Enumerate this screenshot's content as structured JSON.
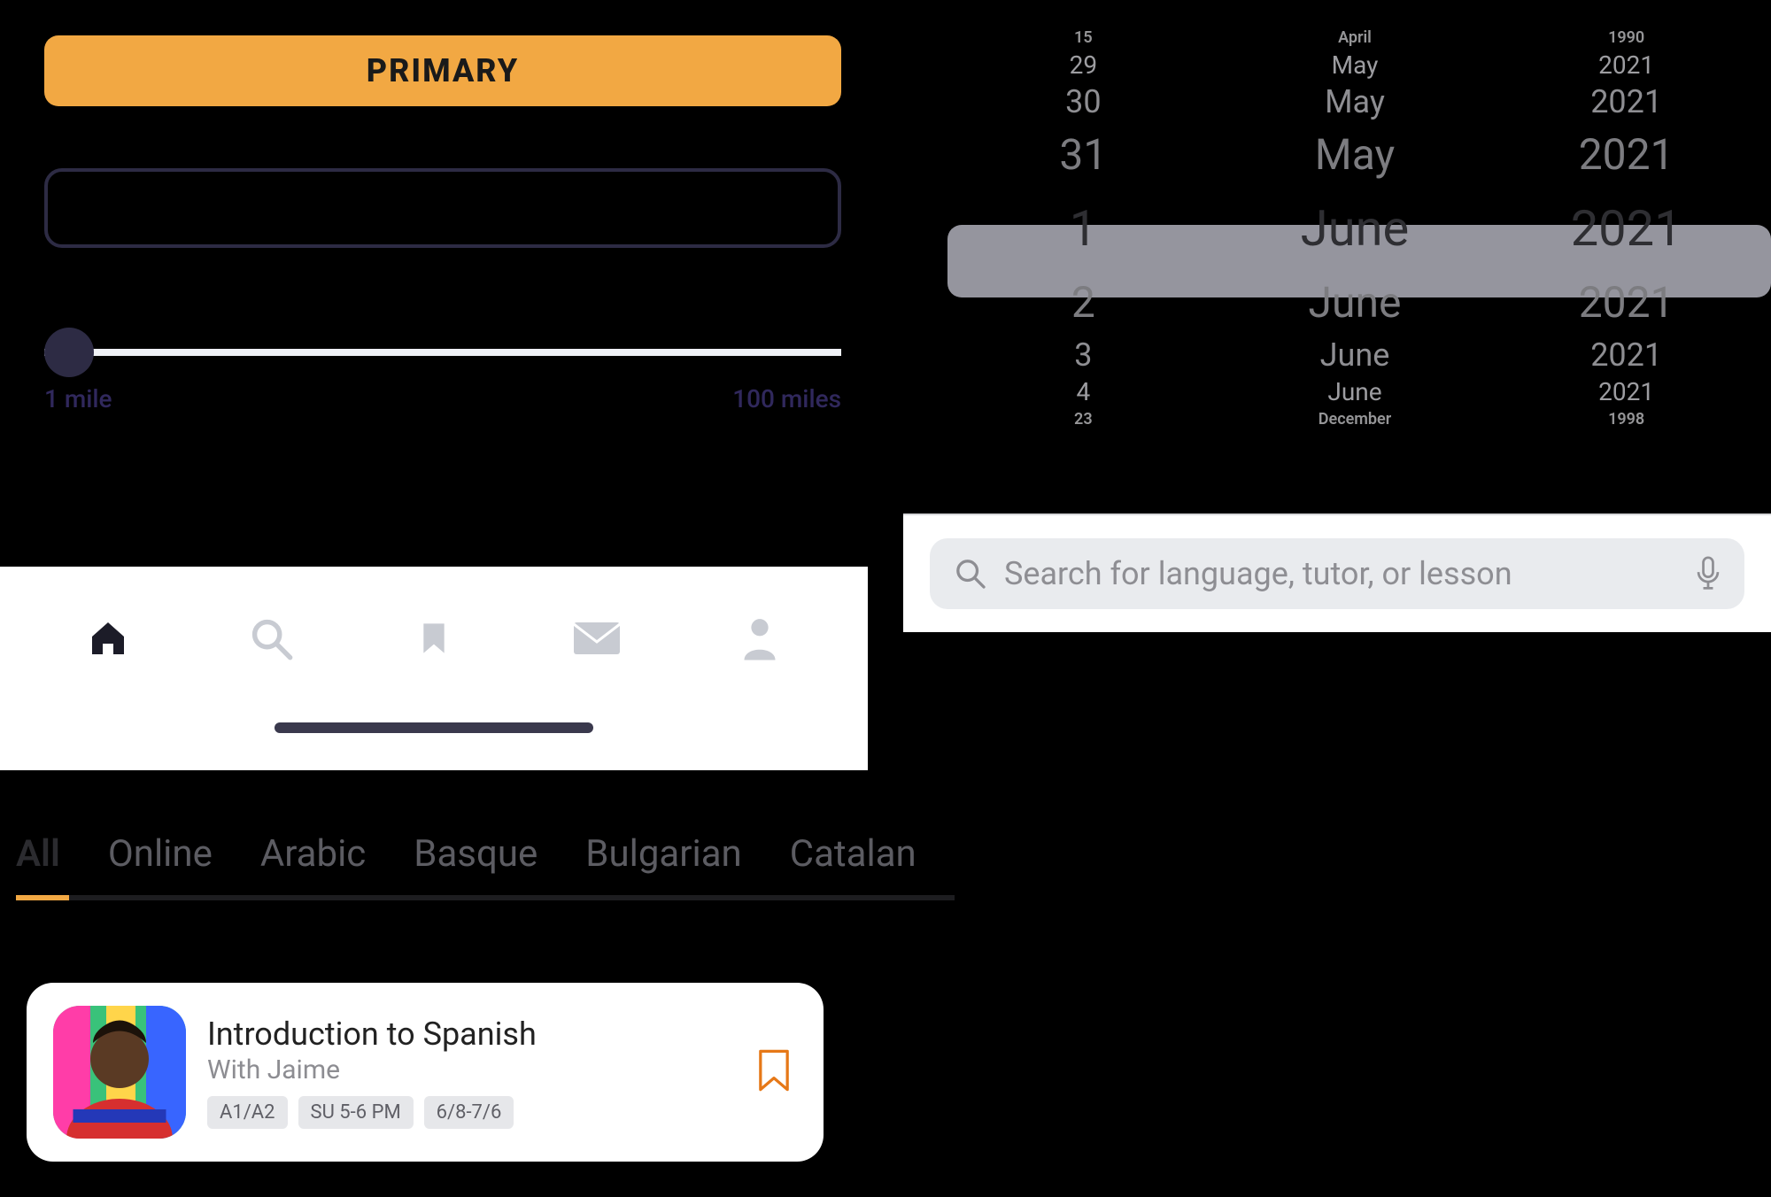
{
  "primary_button": {
    "label": "PRIMARY"
  },
  "slider": {
    "min_label": "1 mile",
    "max_label": "100 miles"
  },
  "nav": {
    "items": [
      {
        "name": "home",
        "active": true
      },
      {
        "name": "search",
        "active": false
      },
      {
        "name": "bookmark",
        "active": false
      },
      {
        "name": "mail",
        "active": false
      },
      {
        "name": "profile",
        "active": false
      }
    ]
  },
  "date_picker": {
    "rows": [
      {
        "day": "15",
        "month": "April",
        "year": "1990",
        "size": "tiny"
      },
      {
        "day": "29",
        "month": "May",
        "year": "2021",
        "size": "sm"
      },
      {
        "day": "30",
        "month": "May",
        "year": "2021",
        "size": "md"
      },
      {
        "day": "31",
        "month": "May",
        "year": "2021",
        "size": "lg"
      },
      {
        "day": "1",
        "month": "June",
        "year": "2021",
        "size": "sel"
      },
      {
        "day": "2",
        "month": "June",
        "year": "2021",
        "size": "lg"
      },
      {
        "day": "3",
        "month": "June",
        "year": "2021",
        "size": "md"
      },
      {
        "day": "4",
        "month": "June",
        "year": "2021",
        "size": "sm"
      },
      {
        "day": "23",
        "month": "December",
        "year": "1998",
        "size": "tiny"
      }
    ]
  },
  "search": {
    "placeholder": "Search for language, tutor, or lesson"
  },
  "lang_tabs": {
    "items": [
      "All",
      "Online",
      "Arabic",
      "Basque",
      "Bulgarian",
      "Catalan"
    ],
    "active_index": 0
  },
  "lesson": {
    "title": "Introduction to Spanish",
    "subtitle": "With Jaime",
    "chips": [
      "A1/A2",
      "SU 5-6 PM",
      "6/8-7/6"
    ]
  }
}
